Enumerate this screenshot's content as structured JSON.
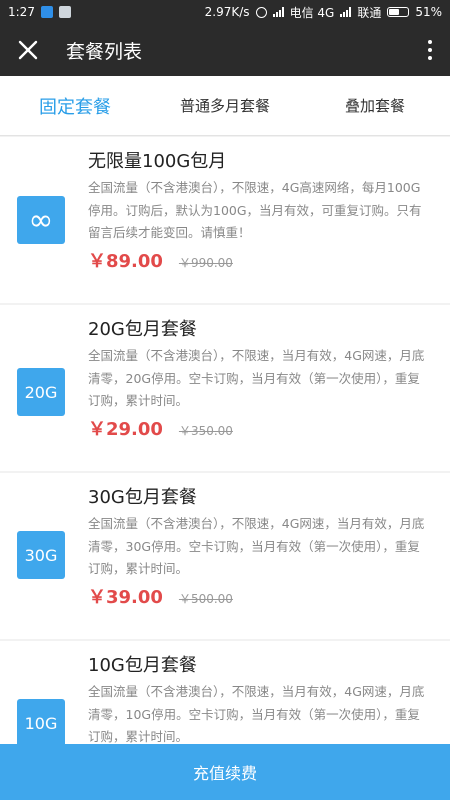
{
  "status_bar": {
    "time": "1:27",
    "network_speed": "2.97K/s",
    "carrier1": "电信 4G",
    "carrier2": "联通",
    "battery": "51%"
  },
  "title_bar": {
    "title": "套餐列表",
    "close_icon": "close-icon",
    "more_icon": "more-vertical-icon"
  },
  "tabs": [
    {
      "label": "固定套餐",
      "active": true
    },
    {
      "label": "普通多月套餐",
      "active": false
    },
    {
      "label": "叠加套餐",
      "active": false
    }
  ],
  "plans": [
    {
      "badge": "∞",
      "title": "无限量100G包月",
      "desc": "全国流量（不含港澳台），不限速，4G高速网络，每月100G停用。订购后，默认为100G，当月有效，可重复订购。只有留言后续才能变回。请慎重！",
      "price": "￥89.00",
      "original_price": "￥990.00"
    },
    {
      "badge": "20G",
      "title": "20G包月套餐",
      "desc": "全国流量（不含港澳台），不限速，当月有效，4G网速，月底清零，20G停用。空卡订购，当月有效（第一次使用），重复订购，累计时间。",
      "price": "￥29.00",
      "original_price": "￥350.00"
    },
    {
      "badge": "30G",
      "title": "30G包月套餐",
      "desc": "全国流量（不含港澳台），不限速，4G网速，当月有效，月底清零，30G停用。空卡订购，当月有效（第一次使用），重复订购，累计时间。",
      "price": "￥39.00",
      "original_price": "￥500.00"
    },
    {
      "badge": "10G",
      "title": "10G包月套餐",
      "desc": "全国流量（不含港澳台），不限速，当月有效，4G网速，月底清零，10G停用。空卡订购，当月有效（第一次使用），重复订购，累计时间。",
      "price": "",
      "original_price": ""
    }
  ],
  "bottom_button": {
    "label": "充值续费"
  },
  "colors": {
    "accent": "#3fa7ec",
    "active_tab": "#2a9ee8",
    "price": "#e24a4a",
    "header_bg": "#2b2b2b"
  }
}
